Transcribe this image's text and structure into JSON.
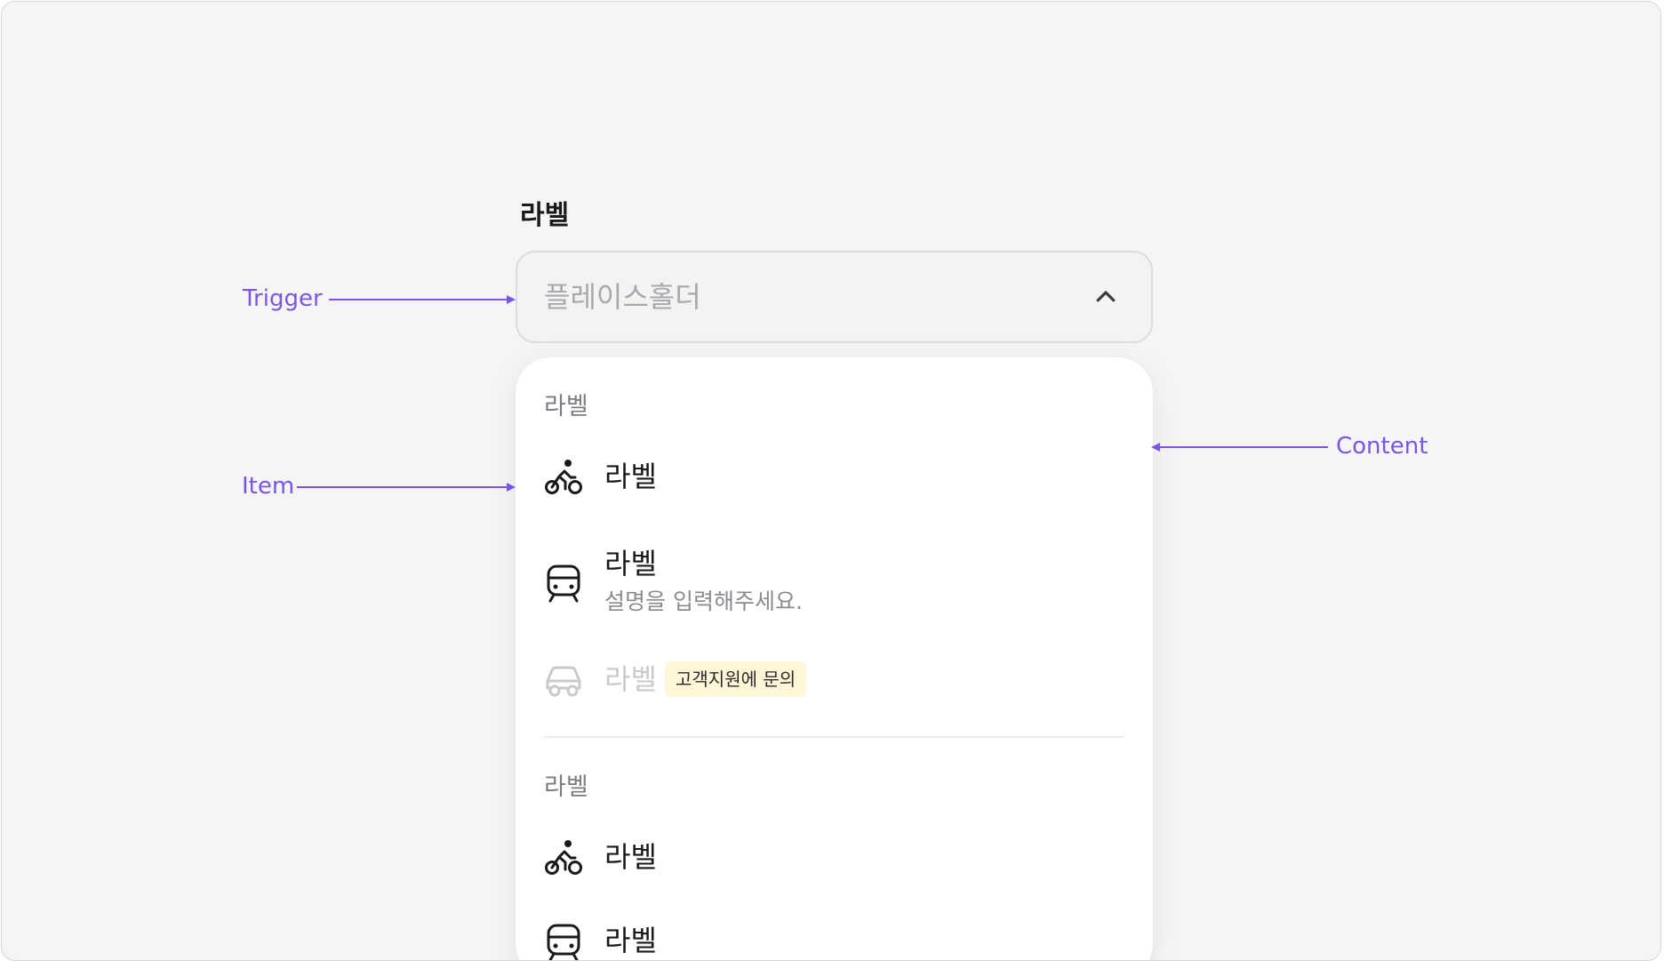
{
  "field": {
    "label": "라벨",
    "placeholder": "플레이스홀더"
  },
  "content": {
    "groups": [
      {
        "label": "라벨",
        "items": [
          {
            "icon": "bicycle-icon",
            "label": "라벨"
          },
          {
            "icon": "train-icon",
            "label": "라벨",
            "description": "설명을 입력해주세요."
          },
          {
            "icon": "car-icon",
            "label": "라벨",
            "disabled": true,
            "badge": "고객지원에 문의"
          }
        ]
      },
      {
        "label": "라벨",
        "items": [
          {
            "icon": "bicycle-icon",
            "label": "라벨"
          },
          {
            "icon": "train-icon",
            "label": "라벨"
          }
        ]
      }
    ]
  },
  "annotations": {
    "trigger": "Trigger",
    "item": "Item",
    "content": "Content"
  },
  "colors": {
    "accent": "#7a56e6",
    "badge_bg": "#fff6d8"
  }
}
